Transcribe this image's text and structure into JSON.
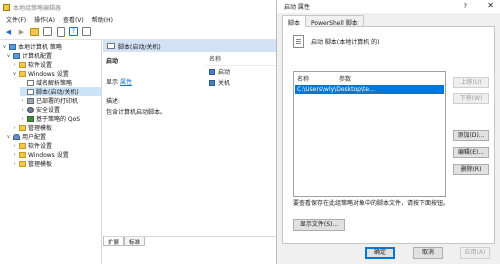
{
  "gpe": {
    "title": "本地组策略编辑器",
    "menu": [
      "文件(F)",
      "操作(A)",
      "查看(V)",
      "帮助(H)"
    ],
    "tree": [
      {
        "label": "本地计算机 策略",
        "icon": "pc",
        "chev": "∨"
      },
      {
        "label": "计算机配置",
        "icon": "pc",
        "chev": "∨"
      },
      {
        "label": "软件设置",
        "icon": "folder",
        "chev": "›"
      },
      {
        "label": "Windows 设置",
        "icon": "folder",
        "chev": "∨"
      },
      {
        "label": "域名解析策略",
        "icon": "doc",
        "chev": ""
      },
      {
        "label": "脚本(启动/关机)",
        "icon": "doc",
        "chev": ""
      },
      {
        "label": "已部署的打印机",
        "icon": "print",
        "chev": "›"
      },
      {
        "label": "安全设置",
        "icon": "gear",
        "chev": "›"
      },
      {
        "label": "基于策略的 QoS",
        "icon": "chart",
        "chev": "›"
      },
      {
        "label": "管理模板",
        "icon": "folder",
        "chev": "›"
      },
      {
        "label": "用户配置",
        "icon": "user",
        "chev": "∨"
      },
      {
        "label": "软件设置",
        "icon": "folder",
        "chev": "›"
      },
      {
        "label": "Windows 设置",
        "icon": "folder",
        "chev": "›"
      },
      {
        "label": "管理模板",
        "icon": "folder",
        "chev": "›"
      }
    ],
    "right_header": "脚本(启动/关机)",
    "desc": {
      "title": "启动",
      "show": "显示",
      "props_link": "属性",
      "desc_label": "描述:",
      "desc_text": "包含计算机启动脚本。"
    },
    "list": {
      "col_name": "名称",
      "items": [
        "启动",
        "关机"
      ]
    },
    "tabs": [
      "扩展",
      "标准"
    ]
  },
  "dialog": {
    "title": "启动 属性",
    "help": "?",
    "close": "✕",
    "tabs": [
      "脚本",
      "PowerShell 脚本"
    ],
    "header_text": "启动 脚本(本地计算机 的)",
    "list_cols": [
      "名称",
      "参数"
    ],
    "selected_row": "C:\\Users\\wly\\Desktop\\te...",
    "side_buttons": [
      "上移(U)",
      "下移(W)",
      "添加(D)...",
      "编辑(E)...",
      "删除(R)"
    ],
    "note": "要查看保存在此组策略对象中的脚本文件，请按下面按钮。",
    "show_files": "显示文件(S)...",
    "ok": "确定",
    "cancel": "取消",
    "apply": "应用(A)"
  }
}
